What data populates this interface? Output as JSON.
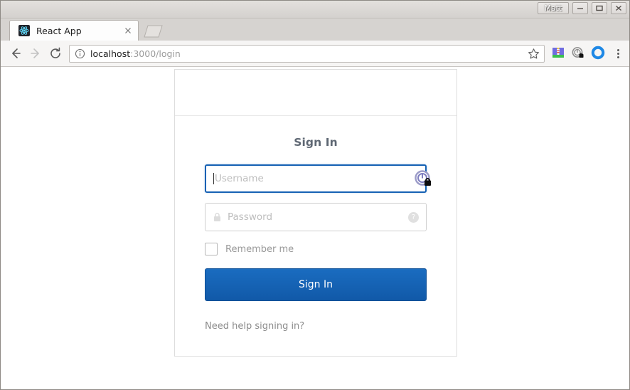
{
  "window": {
    "profile_label": "Matt",
    "minimize_icon": "minimize-icon",
    "maximize_icon": "maximize-icon",
    "close_icon": "close-icon"
  },
  "tabs": [
    {
      "title": "React App",
      "favicon": "react-logo-icon",
      "close_icon": "tab-close-icon",
      "active": true
    }
  ],
  "newtab": {
    "icon": "new-tab-icon"
  },
  "toolbar": {
    "back_icon": "back-arrow-icon",
    "forward_icon": "forward-arrow-icon",
    "reload_icon": "reload-icon",
    "info_icon": "page-info-icon",
    "url_host": "localhost",
    "url_path": ":3000/login",
    "bookmark_icon": "bookmark-star-icon",
    "extensions": [
      {
        "name": "lighthouse-extension-icon"
      },
      {
        "name": "password-manager-extension-icon"
      },
      {
        "name": "blue-circle-extension-icon"
      }
    ],
    "menu_icon": "chrome-menu-icon"
  },
  "signin": {
    "heading": "Sign In",
    "username": {
      "placeholder": "Username",
      "value": "",
      "focused": true,
      "pwmgr_icon": "password-manager-lock-icon"
    },
    "password": {
      "placeholder": "Password",
      "value": "",
      "lock_icon": "lock-icon",
      "help_icon": "?"
    },
    "remember_me_label": "Remember me",
    "remember_me_checked": false,
    "submit_label": "Sign In",
    "help_link_label": "Need help signing in?"
  },
  "colors": {
    "primary_blue": "#1662b4",
    "focus_blue": "#1662b4",
    "heading_grey": "#5e6773",
    "placeholder_grey": "#bdbdbd",
    "card_border": "#dddddd"
  }
}
